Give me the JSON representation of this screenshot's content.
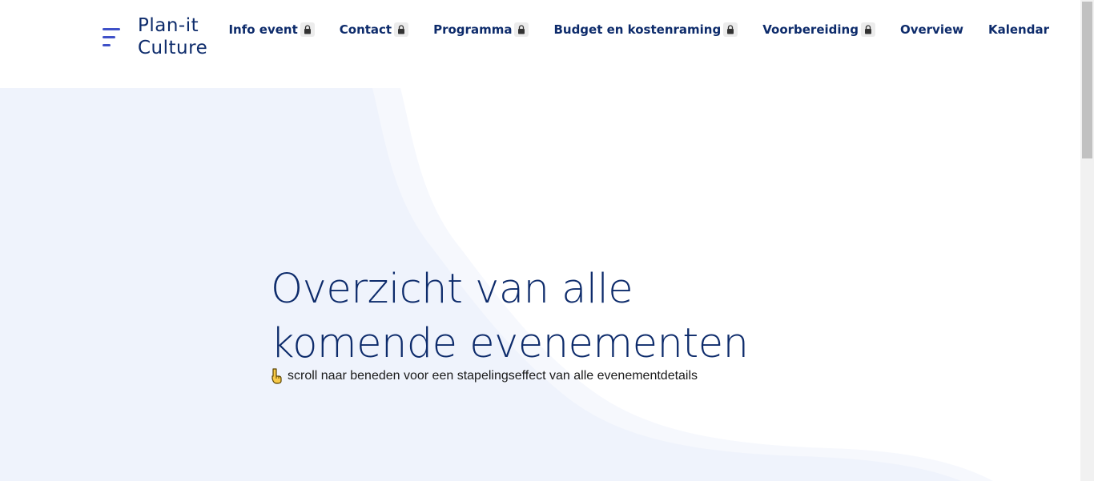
{
  "logo": {
    "line1": "Plan-it",
    "line2": "Culture",
    "icon": "menu-lines-icon",
    "accent_color": "#3f51c8"
  },
  "nav": {
    "items": [
      {
        "label": "Info event",
        "locked": true
      },
      {
        "label": "Contact",
        "locked": true
      },
      {
        "label": "Programma",
        "locked": true
      },
      {
        "label": "Budget en kostenraming",
        "locked": true
      },
      {
        "label": "Voorbereiding",
        "locked": true
      },
      {
        "label": "Overview",
        "locked": false
      },
      {
        "label": "Kalendar",
        "locked": false
      }
    ],
    "lock_icon": "lock-icon",
    "text_color": "#0d2b6b"
  },
  "hero": {
    "title_line1": "Overzicht van alle",
    "title_line2": "komende evenementen",
    "subtitle": "scroll naar beneden voor een stapelingseffect van alle evenementdetails",
    "subtitle_icon": "pointing-down-hand-icon",
    "background_color": "#eff3fc",
    "title_color": "#0d2b6b"
  }
}
